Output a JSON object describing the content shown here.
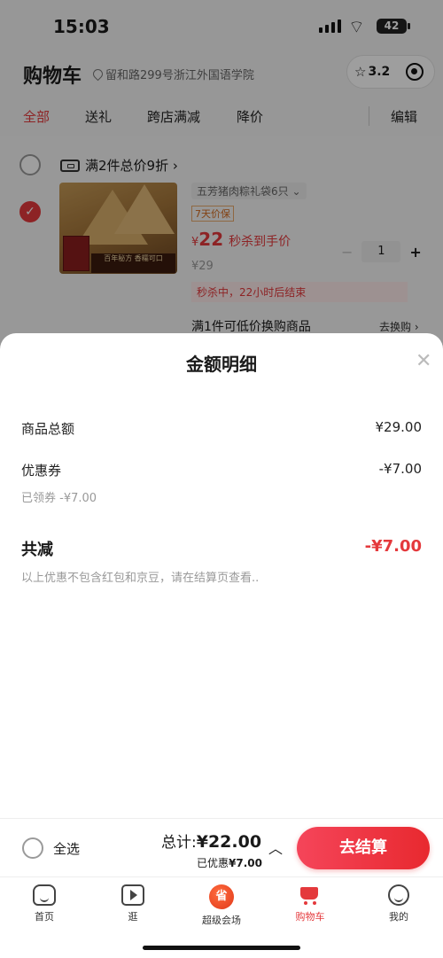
{
  "status_bar": {
    "time": "15:03",
    "battery": "42"
  },
  "header": {
    "title": "购物车",
    "address": "留和路299号浙江外国语学院",
    "rating": "3.2"
  },
  "tabs": [
    "全部",
    "送礼",
    "跨店满减",
    "降价"
  ],
  "edit_label": "编辑",
  "shop": {
    "promo": "满2件总价9折 ›",
    "item": {
      "img_caption": "百年秘方 香糯可口",
      "variant": "五芳猪肉粽礼袋6只 ⌄",
      "warranty": "7天价保",
      "currency": "¥",
      "price": "22",
      "price_desc": "秒杀到手价",
      "original_price": "¥29",
      "qty": "1",
      "flash_note": "秒杀中，22小时后结束",
      "exchange": "满1件可低价换购商品",
      "exchange_link": "去换购 ›"
    }
  },
  "sheet": {
    "title": "金额明细",
    "rows": [
      {
        "label": "商品总额",
        "value": "¥29.00"
      },
      {
        "label": "优惠券",
        "value": "-¥7.00",
        "sub": "已领券 -¥7.00"
      }
    ],
    "total_label": "共减",
    "total_value": "-¥7.00",
    "note": "以上优惠不包含红包和京豆，请在结算页查看.."
  },
  "checkout": {
    "select_all": "全选",
    "sum_label": "总计:",
    "sum_value": "¥22.00",
    "saved_label": "已优惠",
    "saved_value": "¥7.00",
    "pay_label": "去结算"
  },
  "tabbar": [
    "首页",
    "逛",
    "超级会场",
    "购物车",
    "我的"
  ],
  "colors": {
    "accent": "#e4393c"
  }
}
